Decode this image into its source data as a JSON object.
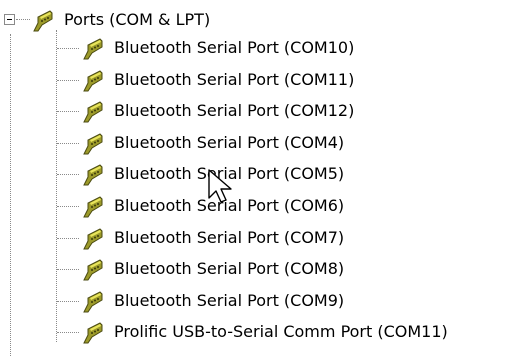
{
  "tree": {
    "parent": {
      "label": "Ports (COM & LPT)",
      "icon": "serial-port-icon",
      "expanded": true
    },
    "children": [
      {
        "label": "Bluetooth Serial Port (COM10)",
        "icon": "serial-port-icon"
      },
      {
        "label": "Bluetooth Serial Port (COM11)",
        "icon": "serial-port-icon"
      },
      {
        "label": "Bluetooth Serial Port (COM12)",
        "icon": "serial-port-icon"
      },
      {
        "label": "Bluetooth Serial Port (COM4)",
        "icon": "serial-port-icon"
      },
      {
        "label": "Bluetooth Serial Port (COM5)",
        "icon": "serial-port-icon"
      },
      {
        "label": "Bluetooth Serial Port (COM6)",
        "icon": "serial-port-icon"
      },
      {
        "label": "Bluetooth Serial Port (COM7)",
        "icon": "serial-port-icon"
      },
      {
        "label": "Bluetooth Serial Port (COM8)",
        "icon": "serial-port-icon"
      },
      {
        "label": "Bluetooth Serial Port (COM9)",
        "icon": "serial-port-icon"
      },
      {
        "label": "Prolific USB-to-Serial Comm Port (COM11)",
        "icon": "serial-port-icon"
      }
    ]
  },
  "colors": {
    "icon_body": "#7a7a1a",
    "icon_highlight": "#e8e45a",
    "guide_line": "#8a8a8a"
  }
}
